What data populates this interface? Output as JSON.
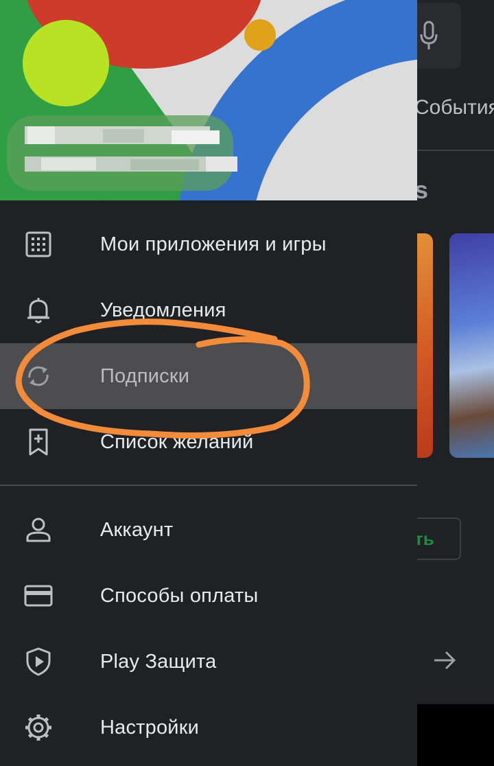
{
  "background_app": {
    "tab_events": "События",
    "section_heading_fragment": "s",
    "install_button_fragment": "ть",
    "mic_icon": "mic-icon",
    "arrow_icon": "arrow-right-icon"
  },
  "drawer": {
    "header": {
      "avatar_color": "#b8e224",
      "account_name": "",
      "account_email": ""
    },
    "items": [
      {
        "label": "Мои приложения и игры",
        "icon": "apps-grid-icon"
      },
      {
        "label": "Уведомления",
        "icon": "bell-icon"
      },
      {
        "label": "Подписки",
        "icon": "refresh-icon",
        "selected": true
      },
      {
        "label": "Список желаний",
        "icon": "bookmark-add-icon"
      },
      {
        "label": "Аккаунт",
        "icon": "person-icon"
      },
      {
        "label": "Способы оплаты",
        "icon": "credit-card-icon"
      },
      {
        "label": "Play Защита",
        "icon": "shield-play-icon"
      },
      {
        "label": "Настройки",
        "icon": "settings-gear-icon"
      }
    ]
  },
  "colors": {
    "drawer_bg": "#202124",
    "selected_bg": "#4d4d4f",
    "annotation_orange": "#f28c3a",
    "accent_green": "#1e8e3e"
  }
}
